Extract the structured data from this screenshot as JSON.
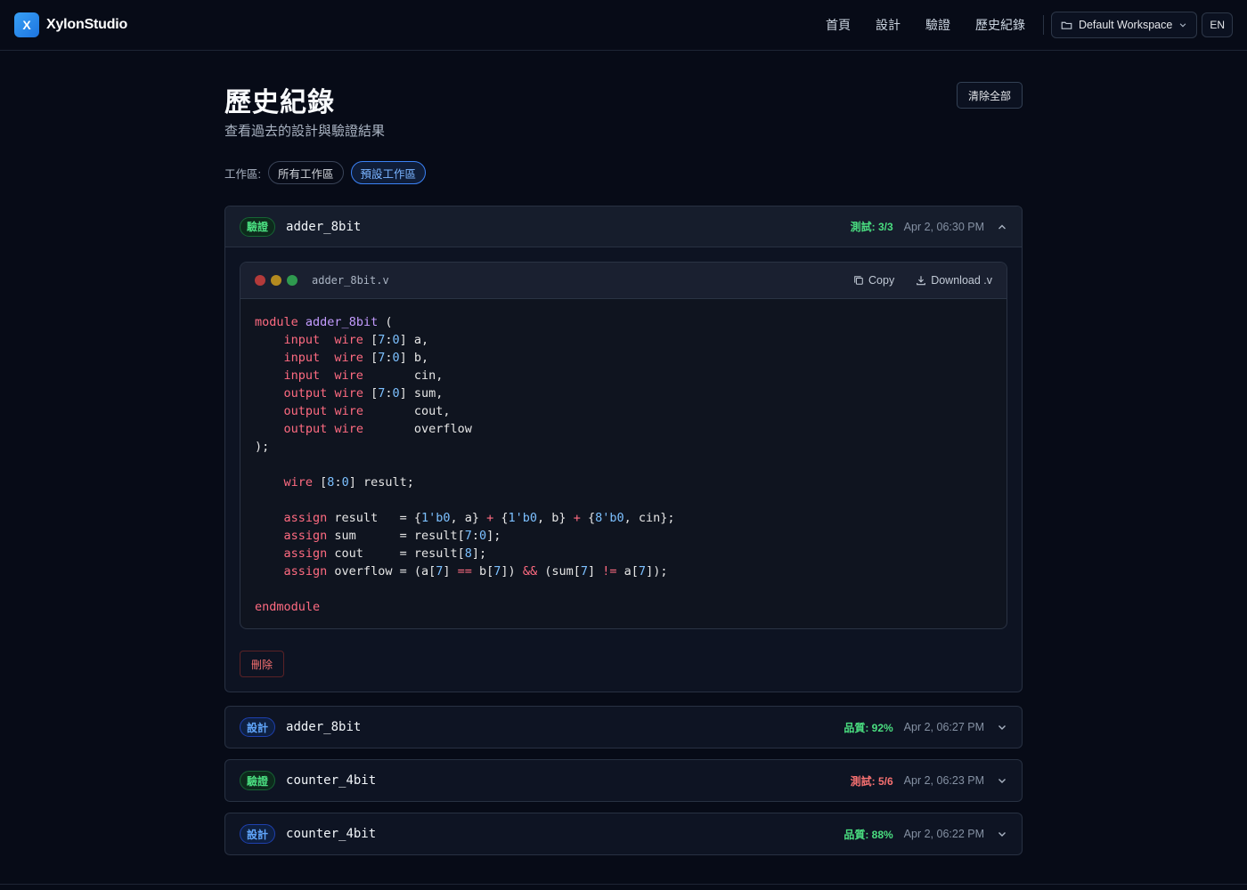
{
  "header": {
    "logo_letter": "X",
    "brand": "XylonStudio",
    "nav": [
      "首頁",
      "設計",
      "驗證",
      "歷史紀錄"
    ],
    "workspace_selected": "Default Workspace",
    "lang": "EN"
  },
  "page": {
    "title": "歷史紀錄",
    "subtitle": "查看過去的設計與驗證結果",
    "clear_all": "清除全部",
    "workspace_label": "工作區:",
    "workspace_chips": [
      "所有工作區",
      "預設工作區"
    ]
  },
  "history": [
    {
      "type_label": "驗證",
      "name": "adder_8bit",
      "metric": "測試: 3/3",
      "time": "Apr 2, 06:30 PM",
      "expanded": true,
      "file": "adder_8bit.v",
      "copy_label": "Copy",
      "download_label": "Download .v",
      "delete_label": "刪除"
    },
    {
      "type_label": "設計",
      "name": "adder_8bit",
      "metric": "品質: 92%",
      "time": "Apr 2, 06:27 PM",
      "expanded": false
    },
    {
      "type_label": "驗證",
      "name": "counter_4bit",
      "metric": "測試: 5/6",
      "time": "Apr 2, 06:23 PM",
      "expanded": false
    },
    {
      "type_label": "設計",
      "name": "counter_4bit",
      "metric": "品質: 88%",
      "time": "Apr 2, 06:22 PM",
      "expanded": false
    }
  ],
  "code_lines": [
    [
      [
        "kw",
        "module"
      ],
      [
        "t",
        " "
      ],
      [
        "fn",
        "adder_8bit"
      ],
      [
        "t",
        " ("
      ]
    ],
    [
      [
        "t",
        "    "
      ],
      [
        "kw",
        "input"
      ],
      [
        "t",
        "  "
      ],
      [
        "kw",
        "wire"
      ],
      [
        "t",
        " ["
      ],
      [
        "nm",
        "7"
      ],
      [
        "t",
        ":"
      ],
      [
        "nm",
        "0"
      ],
      [
        "t",
        "] a,"
      ]
    ],
    [
      [
        "t",
        "    "
      ],
      [
        "kw",
        "input"
      ],
      [
        "t",
        "  "
      ],
      [
        "kw",
        "wire"
      ],
      [
        "t",
        " ["
      ],
      [
        "nm",
        "7"
      ],
      [
        "t",
        ":"
      ],
      [
        "nm",
        "0"
      ],
      [
        "t",
        "] b,"
      ]
    ],
    [
      [
        "t",
        "    "
      ],
      [
        "kw",
        "input"
      ],
      [
        "t",
        "  "
      ],
      [
        "kw",
        "wire"
      ],
      [
        "t",
        "       cin,"
      ]
    ],
    [
      [
        "t",
        "    "
      ],
      [
        "kw",
        "output"
      ],
      [
        "t",
        " "
      ],
      [
        "kw",
        "wire"
      ],
      [
        "t",
        " ["
      ],
      [
        "nm",
        "7"
      ],
      [
        "t",
        ":"
      ],
      [
        "nm",
        "0"
      ],
      [
        "t",
        "] sum,"
      ]
    ],
    [
      [
        "t",
        "    "
      ],
      [
        "kw",
        "output"
      ],
      [
        "t",
        " "
      ],
      [
        "kw",
        "wire"
      ],
      [
        "t",
        "       cout,"
      ]
    ],
    [
      [
        "t",
        "    "
      ],
      [
        "kw",
        "output"
      ],
      [
        "t",
        " "
      ],
      [
        "kw",
        "wire"
      ],
      [
        "t",
        "       overflow"
      ]
    ],
    [
      [
        "t",
        ");"
      ]
    ],
    [
      [
        "t",
        ""
      ]
    ],
    [
      [
        "t",
        "    "
      ],
      [
        "kw",
        "wire"
      ],
      [
        "t",
        " ["
      ],
      [
        "nm",
        "8"
      ],
      [
        "t",
        ":"
      ],
      [
        "nm",
        "0"
      ],
      [
        "t",
        "] result;"
      ]
    ],
    [
      [
        "t",
        ""
      ]
    ],
    [
      [
        "t",
        "    "
      ],
      [
        "kw",
        "assign"
      ],
      [
        "t",
        " result   = {"
      ],
      [
        "nm",
        "1'b0"
      ],
      [
        "t",
        ", a} "
      ],
      [
        "kw",
        "+"
      ],
      [
        "t",
        " {"
      ],
      [
        "nm",
        "1'b0"
      ],
      [
        "t",
        ", b} "
      ],
      [
        "kw",
        "+"
      ],
      [
        "t",
        " {"
      ],
      [
        "nm",
        "8'b0"
      ],
      [
        "t",
        ", cin};"
      ]
    ],
    [
      [
        "t",
        "    "
      ],
      [
        "kw",
        "assign"
      ],
      [
        "t",
        " sum      = result["
      ],
      [
        "nm",
        "7"
      ],
      [
        "t",
        ":"
      ],
      [
        "nm",
        "0"
      ],
      [
        "t",
        "];"
      ]
    ],
    [
      [
        "t",
        "    "
      ],
      [
        "kw",
        "assign"
      ],
      [
        "t",
        " cout     = result["
      ],
      [
        "nm",
        "8"
      ],
      [
        "t",
        "];"
      ]
    ],
    [
      [
        "t",
        "    "
      ],
      [
        "kw",
        "assign"
      ],
      [
        "t",
        " overflow = (a["
      ],
      [
        "nm",
        "7"
      ],
      [
        "t",
        "] "
      ],
      [
        "kw",
        "=="
      ],
      [
        "t",
        " b["
      ],
      [
        "nm",
        "7"
      ],
      [
        "t",
        "]) "
      ],
      [
        "kw",
        "&&"
      ],
      [
        "t",
        " (sum["
      ],
      [
        "nm",
        "7"
      ],
      [
        "t",
        "] "
      ],
      [
        "kw",
        "!="
      ],
      [
        "t",
        " a["
      ],
      [
        "nm",
        "7"
      ],
      [
        "t",
        "]);"
      ]
    ],
    [
      [
        "t",
        ""
      ]
    ],
    [
      [
        "kw",
        "endmodule"
      ]
    ]
  ],
  "colors": {
    "verify_badge": "#4ade80",
    "design_badge": "#60a5fa",
    "metric_good": "#4ade80",
    "metric_bad": "#f87171",
    "accent": "#3b82f6"
  }
}
